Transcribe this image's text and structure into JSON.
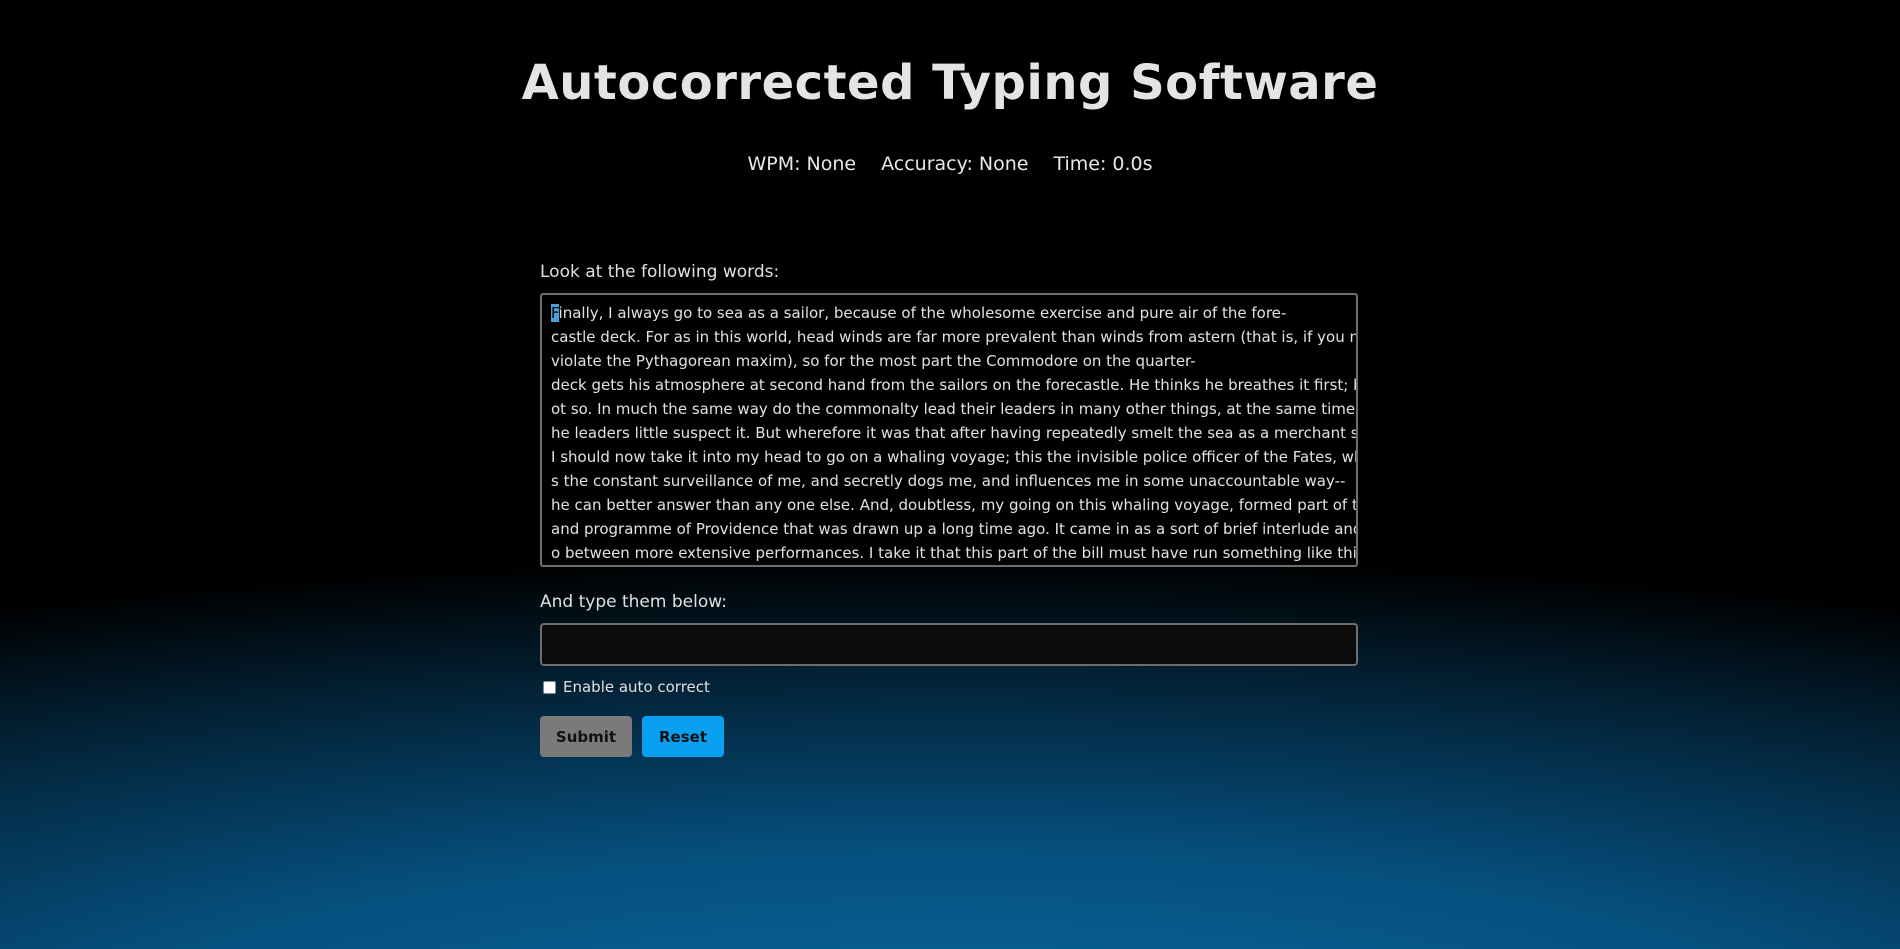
{
  "title": "Autocorrected Typing Software",
  "stats": {
    "wpm": "WPM: None",
    "accuracy": "Accuracy: None",
    "time": "Time: 0.0s"
  },
  "passage_label": "Look at the following words:",
  "passage_first_char": "F",
  "passage_lines": [
    "inally, I always go to sea as a sailor, because of the wholesome exercise and pure air of the fore-",
    "castle deck. For as in this world, head winds are far more prevalent than winds from astern (that is, if you never",
    "violate the Pythagorean maxim), so for the most part the Commodore on the quarter-",
    "deck gets his atmosphere at second hand from the sailors on the forecastle. He thinks he breathes it first; but n",
    "ot so. In much the same way do the commonalty lead their leaders in many other things, at the same time that t",
    "he leaders little suspect it. But wherefore it was that after having repeatedly smelt the sea as a merchant sailor,",
    "I should now take it into my head to go on a whaling voyage; this the invisible police officer of the Fates, who ha",
    "s the constant surveillance of me, and secretly dogs me, and influences me in some unaccountable way--",
    "he can better answer than any one else. And, doubtless, my going on this whaling voyage, formed part of the gr",
    "and programme of Providence that was drawn up a long time ago. It came in as a sort of brief interlude and sol",
    "o between more extensive performances. I take it that this part of the bill must have run something like this:"
  ],
  "type_label": "And type them below:",
  "type_input": {
    "value": "",
    "placeholder": ""
  },
  "autocorrect": {
    "label": "Enable auto correct",
    "checked": false
  },
  "buttons": {
    "submit": "Submit",
    "reset": "Reset"
  },
  "colors": {
    "reset_button": "#0aa0f2",
    "submit_button": "#7a7a7a",
    "cursor_highlight": "#4aa0d8"
  }
}
